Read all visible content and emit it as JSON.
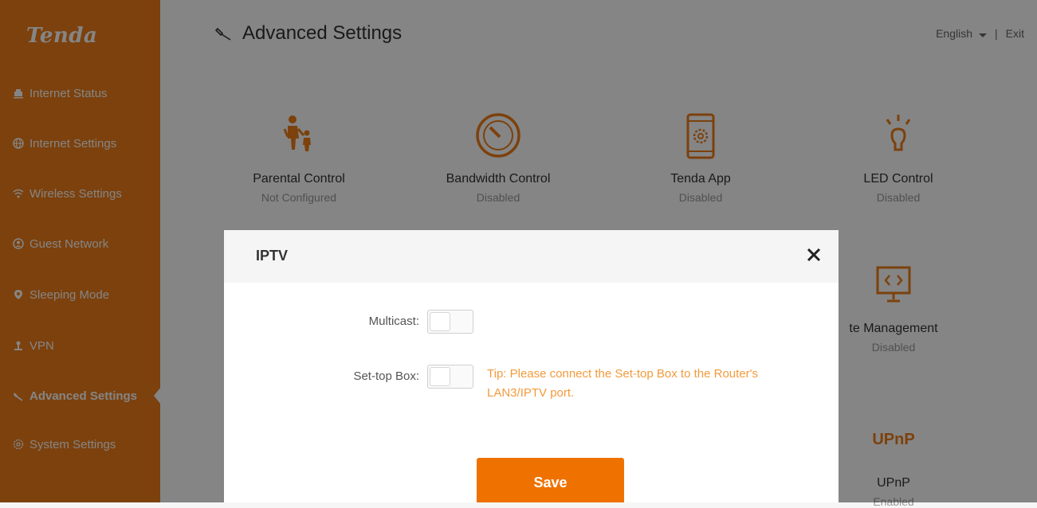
{
  "brand": {
    "logo_text": "Tenda"
  },
  "sidebar": {
    "items": [
      {
        "label": "Internet Status",
        "icon": "network-icon"
      },
      {
        "label": "Internet Settings",
        "icon": "globe-icon"
      },
      {
        "label": "Wireless Settings",
        "icon": "wifi-icon"
      },
      {
        "label": "Guest Network",
        "icon": "guest-icon"
      },
      {
        "label": "Sleeping Mode",
        "icon": "sleep-icon"
      },
      {
        "label": "VPN",
        "icon": "vpn-icon"
      },
      {
        "label": "Advanced Settings",
        "icon": "wrench-icon",
        "active": true
      },
      {
        "label": "System Settings",
        "icon": "gear-icon"
      }
    ]
  },
  "header": {
    "title": "Advanced Settings",
    "language": "English",
    "separator": "|",
    "exit": "Exit"
  },
  "tiles": [
    {
      "name": "Parental Control",
      "status": "Not Configured",
      "icon": "parent-child-icon"
    },
    {
      "name": "Bandwidth Control",
      "status": "Disabled",
      "icon": "gauge-icon"
    },
    {
      "name": "Tenda App",
      "status": "Disabled",
      "icon": "phone-app-icon"
    },
    {
      "name": "LED Control",
      "status": "Disabled",
      "icon": "bulb-icon"
    },
    {
      "name": "te Management",
      "status": "Disabled",
      "icon": "monitor-code-icon"
    },
    {
      "name": "UPnP",
      "status": "Enabled",
      "icon": "upnp-icon",
      "icon_text": "UPnP"
    }
  ],
  "modal": {
    "title": "IPTV",
    "multicast_label": "Multicast:",
    "multicast_on": false,
    "settop_label": "Set-top Box:",
    "settop_on": false,
    "tip": "Tip: Please connect the Set-top Box to the Router's LAN3/IPTV port.",
    "save_label": "Save"
  },
  "colors": {
    "brand_orange": "#ee7d1a",
    "save_orange": "#ef7100",
    "tip_orange": "#f39a3c"
  }
}
